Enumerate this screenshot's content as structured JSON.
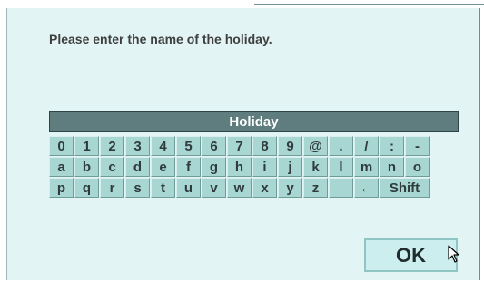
{
  "dialog": {
    "prompt": "Please enter the name of the holiday.",
    "name_value": "Holiday",
    "ok_label": "OK"
  },
  "keyboard": {
    "rows": [
      [
        "0",
        "1",
        "2",
        "3",
        "4",
        "5",
        "6",
        "7",
        "8",
        "9",
        "@",
        ".",
        "/",
        ":",
        "-"
      ],
      [
        "a",
        "b",
        "c",
        "d",
        "e",
        "f",
        "g",
        "h",
        "i",
        "j",
        "k",
        "l",
        "m",
        "n",
        "o"
      ],
      [
        "p",
        "q",
        "r",
        "s",
        "t",
        "u",
        "v",
        "w",
        "x",
        "y",
        "z",
        "",
        "←",
        "Shift"
      ]
    ]
  },
  "icons": {
    "backspace": "left-arrow-icon",
    "pointer": "mouse-pointer-icon"
  },
  "colors": {
    "dialog_bg": "#e3f4f5",
    "field_bg": "#5f7d7f",
    "key_bg": "#a8d6d3",
    "ok_bg": "#cdeeee"
  }
}
